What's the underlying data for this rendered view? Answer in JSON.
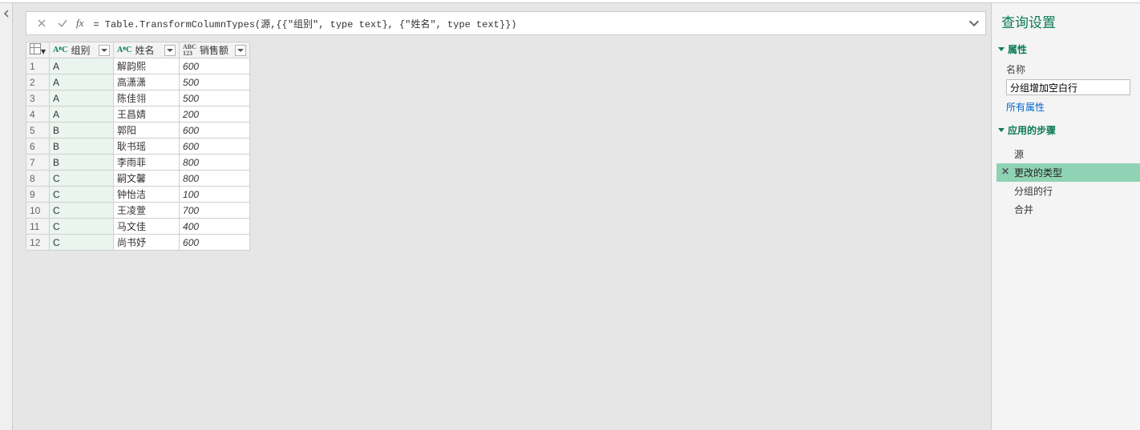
{
  "formula": "= Table.TransformColumnTypes(源,{{\"组别\", type text}, {\"姓名\", type text}})",
  "columns": {
    "group": {
      "label": "组别",
      "type_icon": "AᴮC"
    },
    "name": {
      "label": "姓名",
      "type_icon": "AᴮC"
    },
    "sales": {
      "label": "销售额",
      "type_icon": "ABC\n123"
    }
  },
  "rows": [
    {
      "n": "1",
      "group": "A",
      "name": "解韵熙",
      "sales": "600"
    },
    {
      "n": "2",
      "group": "A",
      "name": "高潇潇",
      "sales": "500"
    },
    {
      "n": "3",
      "group": "A",
      "name": "陈佳翎",
      "sales": "500"
    },
    {
      "n": "4",
      "group": "A",
      "name": "王昌婧",
      "sales": "200"
    },
    {
      "n": "5",
      "group": "B",
      "name": "郭阳",
      "sales": "600"
    },
    {
      "n": "6",
      "group": "B",
      "name": "耿书瑶",
      "sales": "600"
    },
    {
      "n": "7",
      "group": "B",
      "name": "李雨菲",
      "sales": "800"
    },
    {
      "n": "8",
      "group": "C",
      "name": "嗣文馨",
      "sales": "800"
    },
    {
      "n": "9",
      "group": "C",
      "name": "钟怡洁",
      "sales": "100"
    },
    {
      "n": "10",
      "group": "C",
      "name": "王凌萱",
      "sales": "700"
    },
    {
      "n": "11",
      "group": "C",
      "name": "马文佳",
      "sales": "400"
    },
    {
      "n": "12",
      "group": "C",
      "name": "尚书妤",
      "sales": "600"
    }
  ],
  "right_panel": {
    "title": "查询设置",
    "properties": {
      "header": "属性",
      "name_label": "名称",
      "name_value": "分组增加空白行",
      "all_props": "所有属性"
    },
    "applied_steps": {
      "header": "应用的步骤",
      "items": [
        {
          "label": "源",
          "selected": false,
          "deletable": false
        },
        {
          "label": "更改的类型",
          "selected": true,
          "deletable": true
        },
        {
          "label": "分组的行",
          "selected": false,
          "deletable": false
        },
        {
          "label": "合并",
          "selected": false,
          "deletable": false
        }
      ]
    }
  }
}
